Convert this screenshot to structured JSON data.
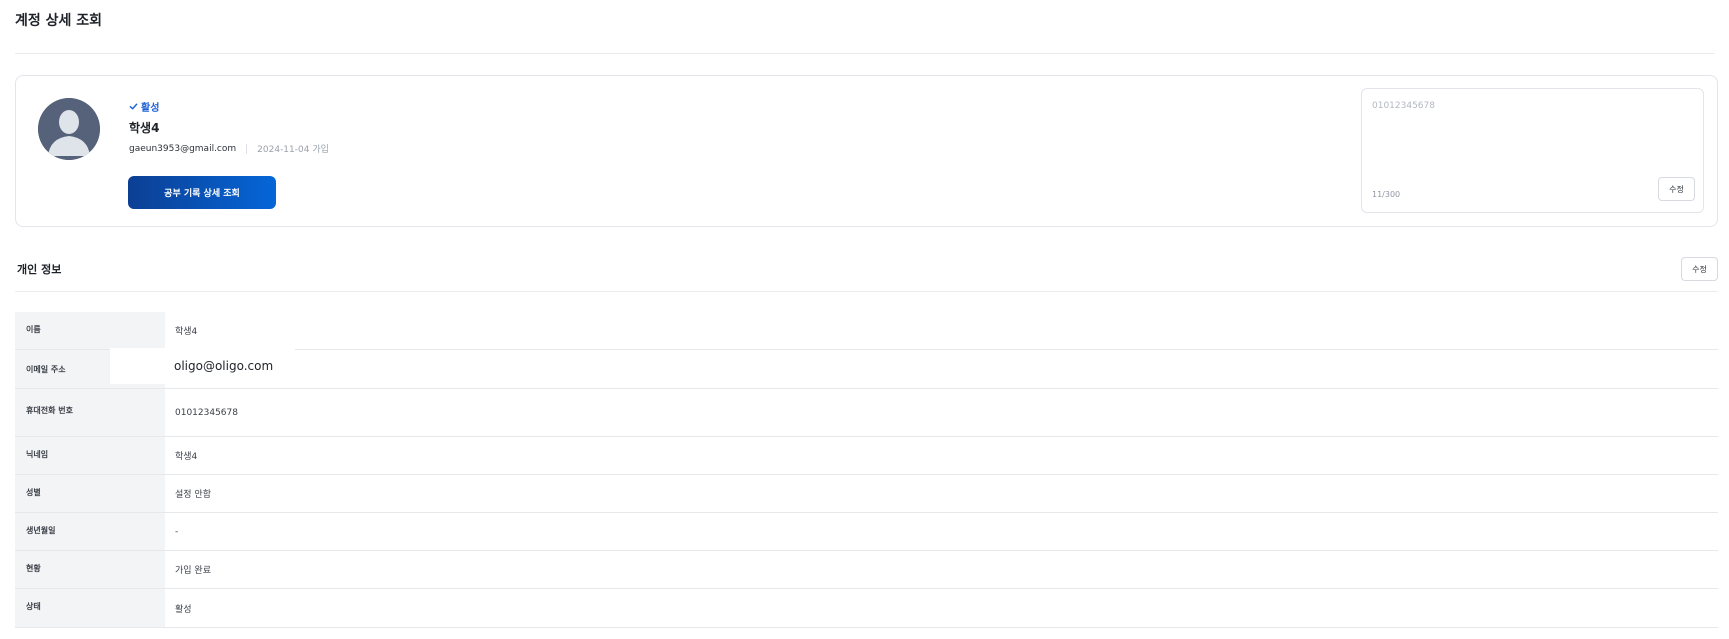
{
  "page": {
    "title": "계정 상세 조회"
  },
  "profile": {
    "status": "활성",
    "name": "학생4",
    "email": "gaeun3953@gmail.com",
    "joined": "2024-11-04 가입",
    "study_button": "공부 기록 상세 조회",
    "memo": {
      "text": "01012345678",
      "count": "11/300",
      "edit_label": "수정"
    }
  },
  "personal_info": {
    "title": "개인 정보",
    "edit_label": "수정",
    "rows": [
      {
        "label": "이름",
        "value": "학생4"
      },
      {
        "label": "이메일 주소",
        "value": "oligo@oligo.com"
      },
      {
        "label": "휴대전화 번호",
        "value": "01012345678"
      },
      {
        "label": "닉네임",
        "value": "학생4"
      },
      {
        "label": "성별",
        "value": "설정 안함"
      },
      {
        "label": "생년월일",
        "value": "-"
      },
      {
        "label": "현황",
        "value": "가입 완료"
      },
      {
        "label": "상태",
        "value": "활성"
      }
    ]
  },
  "colors": {
    "accent": "#1e63d6",
    "button_gradient_start": "#0c3f94",
    "button_gradient_end": "#0566d8",
    "avatar_bg": "#56627a"
  }
}
